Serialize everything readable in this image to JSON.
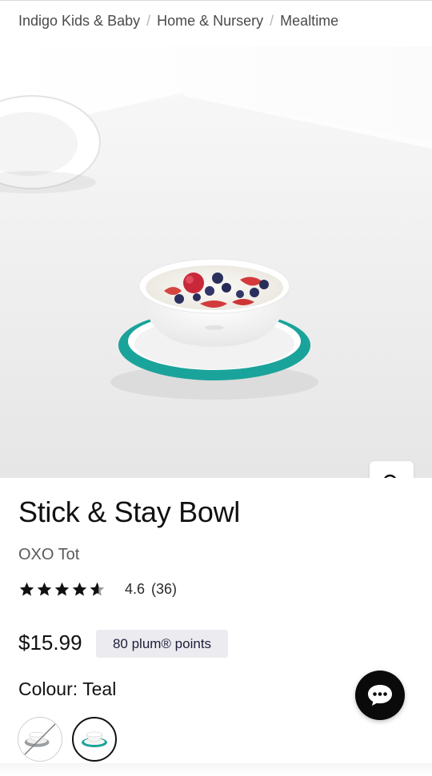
{
  "breadcrumb": {
    "items": [
      "Indigo Kids & Baby",
      "Home & Nursery",
      "Mealtime"
    ],
    "separator": "/"
  },
  "gallery": {
    "image_alt": "Stick & Stay Bowl with yogurt and berries on a white table",
    "slide_count": 4,
    "active_slide": 2,
    "zoom_icon": "search-icon"
  },
  "product": {
    "title": "Stick & Stay Bowl",
    "brand": "OXO Tot",
    "rating": "4.6",
    "rating_value": 4.6,
    "review_count": "(36)",
    "price": "$15.99",
    "points": "80 plum® points",
    "colour_label": "Colour: Teal",
    "swatches": [
      {
        "name": "Grey",
        "unavailable": true
      },
      {
        "name": "Teal",
        "selected": true
      }
    ]
  },
  "chat": {
    "icon": "chat-bubble-icon"
  },
  "colors": {
    "accent_teal": "#1aa39a",
    "text": "#111111",
    "points_bg": "#ececf0",
    "chat_bg": "#0a0a0a"
  }
}
